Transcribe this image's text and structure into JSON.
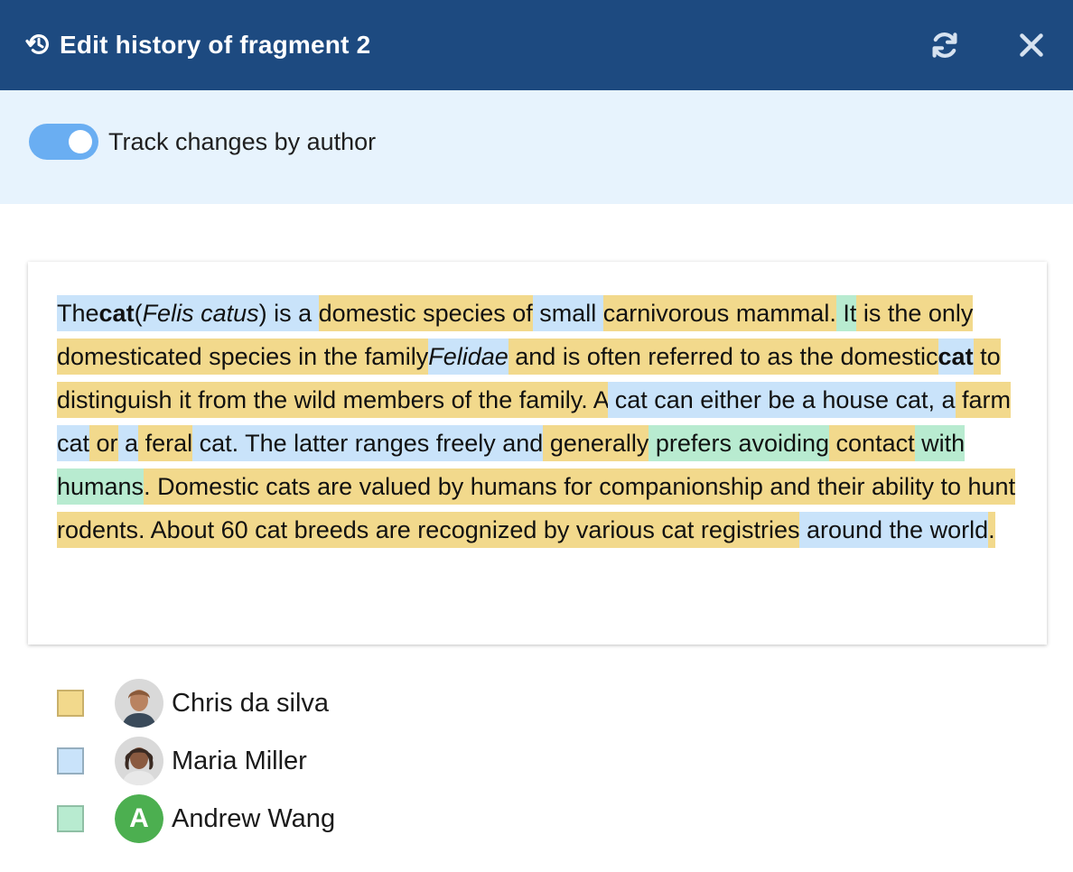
{
  "header": {
    "title": "Edit history of fragment 2",
    "icon": "history-icon",
    "actions": [
      "refresh-icon",
      "close-icon"
    ],
    "background": "#1d4a80"
  },
  "toolbar": {
    "toggle_label": "Track changes by author",
    "toggle_on": true,
    "background": "#e7f3fd"
  },
  "content": {
    "segments": [
      {
        "text": "The",
        "author": "maria"
      },
      {
        "text": "cat",
        "author": "maria",
        "style": "b"
      },
      {
        "text": "(",
        "author": "maria"
      },
      {
        "text": "Felis catus",
        "author": "maria",
        "style": "i"
      },
      {
        "text": ") is a ",
        "author": "maria"
      },
      {
        "text": "domestic species of",
        "author": "chris"
      },
      {
        "text": " small ",
        "author": "maria"
      },
      {
        "text": "carnivorous mammal.",
        "author": "chris"
      },
      {
        "text": " It",
        "author": "andrew"
      },
      {
        "text": " is the only domesticated species in the family",
        "author": "chris"
      },
      {
        "text": "Felidae",
        "author": "maria",
        "style": "i"
      },
      {
        "text": " and is often referred to as the domestic",
        "author": "chris"
      },
      {
        "text": "cat",
        "author": "maria",
        "style": "b"
      },
      {
        "text": " to distinguish it from the wild members of the family.",
        "author": "chris"
      },
      {
        "text": " A",
        "author": "chris"
      },
      {
        "text": " cat can either be a house cat, a",
        "author": "maria"
      },
      {
        "text": " farm",
        "author": "chris"
      },
      {
        "text": " cat",
        "author": "maria"
      },
      {
        "text": " or",
        "author": "chris"
      },
      {
        "text": " a",
        "author": "maria"
      },
      {
        "text": " feral",
        "author": "chris"
      },
      {
        "text": " cat. The latter ranges freely and",
        "author": "maria"
      },
      {
        "text": " generally",
        "author": "chris"
      },
      {
        "text": " prefers avoiding",
        "author": "andrew"
      },
      {
        "text": " contact",
        "author": "chris"
      },
      {
        "text": " with humans",
        "author": "andrew"
      },
      {
        "text": ". Domestic cats are valued by humans for companionship and their ability to hunt rodents. About 60 cat breeds are recognized by various cat registries",
        "author": "chris"
      },
      {
        "text": " around the world",
        "author": "maria"
      },
      {
        "text": ".",
        "author": "chris"
      }
    ]
  },
  "legend": [
    {
      "name": "Chris da silva",
      "color": "#f2d98c",
      "border": "#c9b06a",
      "avatar": "photo",
      "avatar_color": "#8a5a3a"
    },
    {
      "name": "Maria Miller",
      "color": "#c9e3fa",
      "border": "#95aebf",
      "avatar": "photo",
      "avatar_color": "#3a2a22"
    },
    {
      "name": "Andrew Wang",
      "color": "#b8ebd0",
      "border": "#8fbfa5",
      "avatar": "letter",
      "avatar_letter": "A",
      "avatar_color": "#4caf50"
    }
  ]
}
